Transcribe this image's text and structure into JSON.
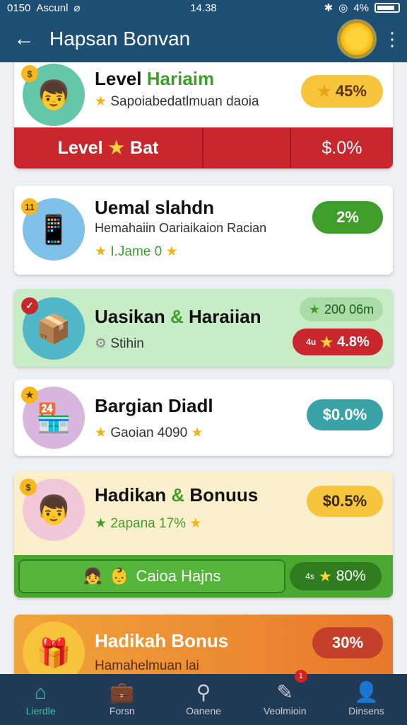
{
  "status_bar": {
    "left": "0150",
    "carrier": "Ascunl",
    "time": "14.38",
    "battery": "4%"
  },
  "app_bar": {
    "title": "Hapsan Bonvan"
  },
  "colors": {
    "primary": "#1d4e73",
    "nav_bg": "#213a55",
    "accent_green": "#3e9e2a",
    "accent_red": "#c8272d",
    "accent_orange": "#e8782b",
    "accent_yellow": "#f7c53c"
  },
  "cards": [
    {
      "title_a": "Level",
      "title_b": "Hariaim",
      "subtitle": "Sapoiabedatlmuan daoia",
      "pill": "45%",
      "thumb_badge": "$",
      "strip_left": "Level",
      "strip_left_b": "Bat",
      "strip_right": "$.0%"
    },
    {
      "title": "Uemal slahdn",
      "subtitle": "Hemahaiin Oariaikaion Racian",
      "meta": "I.Jame 0",
      "pill": "2%",
      "thumb_badge": "11"
    },
    {
      "title_a": "Uasikan",
      "title_b": "Haraiian",
      "subtitle": "Stihin",
      "pill_top": "200 06m",
      "pill_bottom": "4.8%",
      "pill_bottom_prefix": "4u"
    },
    {
      "title": "Bargian Diadl",
      "subtitle": "Gaoian 4090",
      "pill": "$0.0%"
    },
    {
      "title_a": "Hadikan",
      "title_b": "Bonuus",
      "subtitle": "2apana 17%",
      "pill": "$0.5%",
      "strip_label": "Caioa Hajns",
      "strip_pill": "80%",
      "strip_pill_prefix": "4s"
    },
    {
      "title": "Hadikah Bonus",
      "subtitle": "Hamahelmuan lai",
      "pill": "30%"
    }
  ],
  "nav": [
    {
      "label": "Lierdle",
      "icon": "home-icon"
    },
    {
      "label": "Forsn",
      "icon": "briefcase-icon"
    },
    {
      "label": "Oanene",
      "icon": "search-icon"
    },
    {
      "label": "Veolmioin",
      "icon": "edit-icon",
      "badge": "1"
    },
    {
      "label": "Dinsens",
      "icon": "profile-icon"
    }
  ]
}
